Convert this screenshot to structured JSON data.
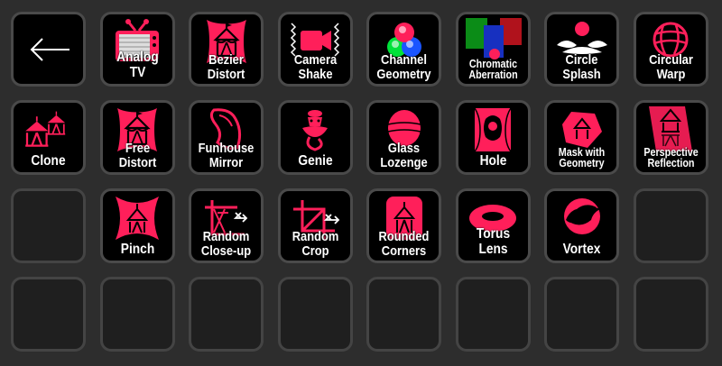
{
  "accent_color": "#ff1f5a",
  "keys": [
    {
      "label": "",
      "icon": "back-arrow-icon"
    },
    {
      "label": "Analog TV",
      "icon": "tv-icon"
    },
    {
      "label": "Bezier Distort",
      "icon": "circus-tent-icon"
    },
    {
      "label": "Camera\nShake",
      "icon": "camera-shake-icon"
    },
    {
      "label": "Channel\nGeometry",
      "icon": "rgb-circles-icon"
    },
    {
      "label": "Chromatic\nAberration",
      "icon": "chromatic-icon"
    },
    {
      "label": "Circle\nSplash",
      "icon": "circle-splash-icon"
    },
    {
      "label": "Circular\nWarp",
      "icon": "warped-sphere-icon"
    },
    {
      "label": "Clone",
      "icon": "circus-tents-icon"
    },
    {
      "label": "Free Distort",
      "icon": "circus-tent-icon"
    },
    {
      "label": "Funhouse\nMirror",
      "icon": "wavy-mirror-icon"
    },
    {
      "label": "Genie",
      "icon": "genie-icon"
    },
    {
      "label": "Glass\nLozenge",
      "icon": "lozenge-icon"
    },
    {
      "label": "Hole",
      "icon": "hole-icon"
    },
    {
      "label": "Mask with\nGeometry",
      "icon": "mask-polygon-icon"
    },
    {
      "label": "Perspective\nReflection",
      "icon": "reflection-icon"
    },
    {
      "label": "",
      "icon": ""
    },
    {
      "label": "Pinch",
      "icon": "pinch-icon"
    },
    {
      "label": "Random\nClose-up",
      "icon": "random-closeup-icon"
    },
    {
      "label": "Random Crop",
      "icon": "random-crop-icon"
    },
    {
      "label": "Rounded\nCorners",
      "icon": "rounded-tent-icon"
    },
    {
      "label": "Torus Lens",
      "icon": "torus-icon"
    },
    {
      "label": "Vortex",
      "icon": "vortex-icon"
    },
    {
      "label": "",
      "icon": ""
    },
    {
      "label": "",
      "icon": ""
    },
    {
      "label": "",
      "icon": ""
    },
    {
      "label": "",
      "icon": ""
    },
    {
      "label": "",
      "icon": ""
    },
    {
      "label": "",
      "icon": ""
    },
    {
      "label": "",
      "icon": ""
    },
    {
      "label": "",
      "icon": ""
    },
    {
      "label": "",
      "icon": ""
    }
  ]
}
